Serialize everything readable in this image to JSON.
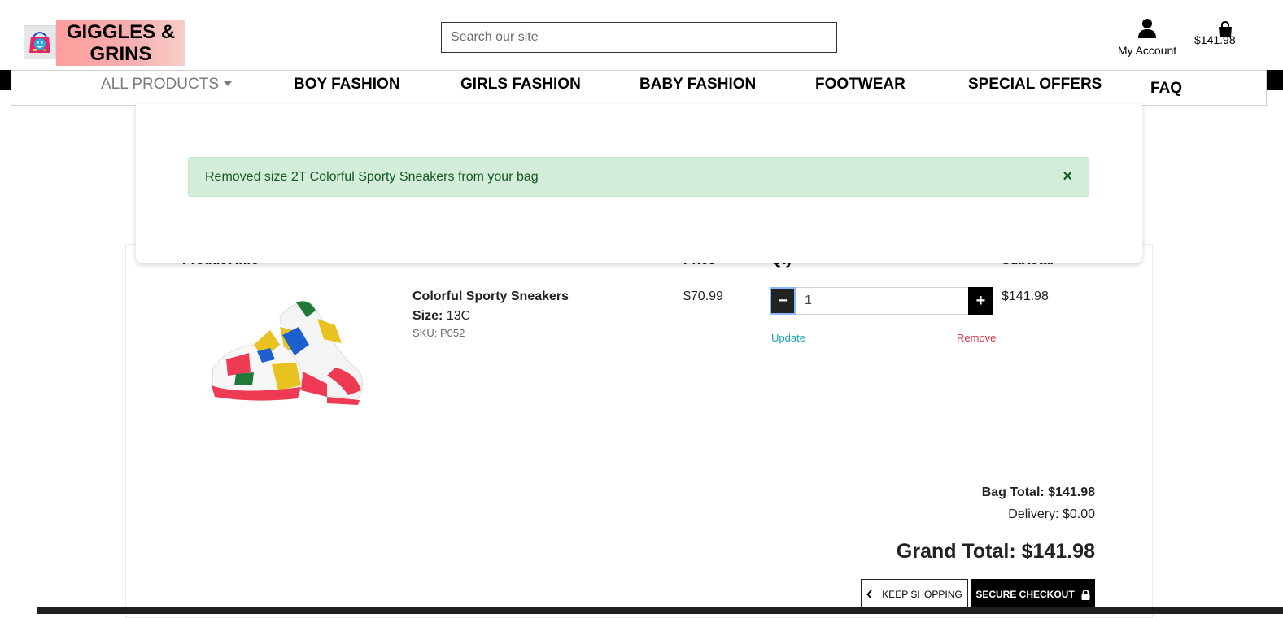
{
  "header": {
    "logo_text": "GIGGLES & GRINS",
    "search_placeholder": "Search our site",
    "account_label": "My Account",
    "bag_total": "$141.98"
  },
  "nav": {
    "items": [
      {
        "label": "ALL PRODUCTS"
      },
      {
        "label": "BOY FASHION"
      },
      {
        "label": "GIRLS FASHION"
      },
      {
        "label": "BABY FASHION"
      },
      {
        "label": "FOOTWEAR"
      },
      {
        "label": "SPECIAL OFFERS"
      },
      {
        "label": "FAQ"
      }
    ]
  },
  "toast": {
    "message": "Removed size 2T Colorful Sporty Sneakers from your bag",
    "close": "×"
  },
  "bag": {
    "columns": [
      "Product Info",
      "Price",
      "Qty",
      "Subtotal"
    ],
    "item": {
      "name": "Colorful Sporty Sneakers",
      "size_label": "Size:",
      "size_value": "13C",
      "sku": "SKU: P052",
      "price": "$70.99",
      "qty": "1",
      "update": "Update",
      "remove": "Remove",
      "subtotal": "$141.98"
    },
    "bag_total": "Bag Total: $141.98",
    "delivery": "Delivery: $0.00",
    "grand_total": "Grand Total: $141.98",
    "keep_shopping": "KEEP SHOPPING",
    "secure_checkout": "SECURE CHECKOUT"
  },
  "icons": {
    "logo": "shopping-bag-face-icon",
    "account": "user-icon",
    "bag": "shopping-bag-icon",
    "chevron": "chevron-left-icon",
    "lock": "lock-icon",
    "close": "close-icon"
  },
  "colors": {
    "alert_bg": "#d4edda",
    "alert_text": "#155724",
    "update_link": "#17a2b8",
    "remove_link": "#dc3545",
    "logo_bg": "#ff9d9d"
  }
}
